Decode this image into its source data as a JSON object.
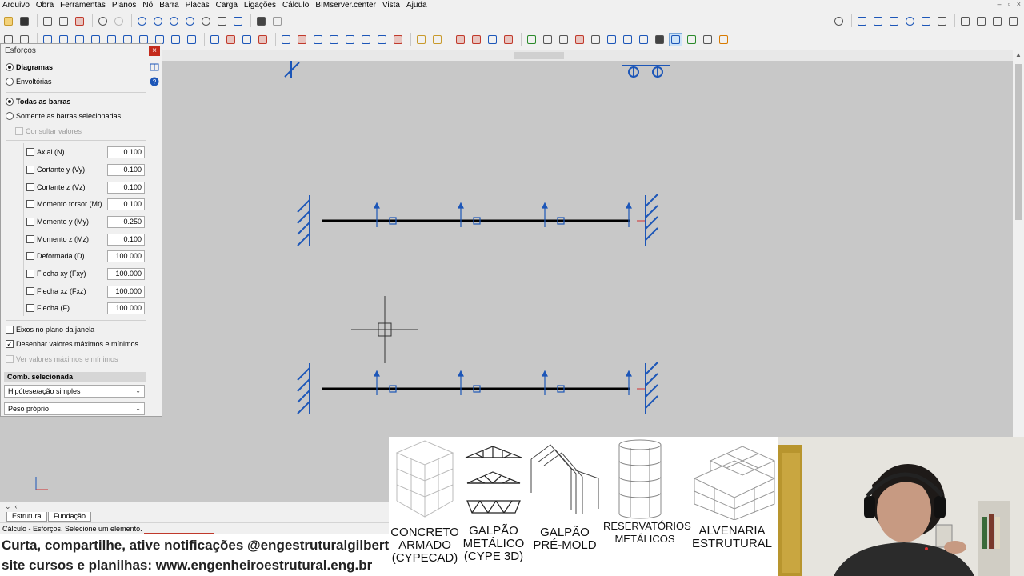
{
  "menu": {
    "items": [
      "Arquivo",
      "Obra",
      "Ferramentas",
      "Planos",
      "Nó",
      "Barra",
      "Placas",
      "Carga",
      "Ligações",
      "Cálculo",
      "BIMserver.center",
      "Vista",
      "Ajuda"
    ]
  },
  "panel": {
    "title": "Esforços",
    "close_label": "×",
    "mode_diagramas": "Diagramas",
    "mode_envoltorias": "Envoltórias",
    "bars_all": "Todas as barras",
    "bars_selected": "Somente as barras selecionadas",
    "consult_values": "Consultar valores",
    "efforts": [
      {
        "label": "Axial (N)",
        "value": "0.100"
      },
      {
        "label": "Cortante y (Vy)",
        "value": "0.100"
      },
      {
        "label": "Cortante z (Vz)",
        "value": "0.100"
      },
      {
        "label": "Momento torsor (Mt)",
        "value": "0.100"
      },
      {
        "label": "Momento y (My)",
        "value": "0.250"
      },
      {
        "label": "Momento z (Mz)",
        "value": "0.100"
      },
      {
        "label": "Deformada (D)",
        "value": "100.000"
      },
      {
        "label": "Flecha xy (Fxy)",
        "value": "100.000"
      },
      {
        "label": "Flecha xz (Fxz)",
        "value": "100.000"
      },
      {
        "label": "Flecha (F)",
        "value": "100.000"
      }
    ],
    "axes_in_window": "Eixos no plano da janela",
    "draw_max_min": "Desenhar valores máximos e mínimos",
    "view_max_min": "Ver valores máximos e mínimos",
    "comb_header": "Comb. selecionada",
    "select_hypothesis": "Hipótese/ação simples",
    "select_load": "Peso próprio"
  },
  "bottom": {
    "tab_estrutura": "Estrutura",
    "tab_fundacao": "Fundação",
    "status": "Cálculo - Esforços. Selecione um elemento.",
    "line1": "Curta, compartilhe, ative notificações @engestruturalgilberto",
    "line2": "site cursos e planilhas: www.engenheiroestrutural.eng.br"
  },
  "banner": {
    "items": [
      {
        "label": "CONCRETO\nARMADO\n(CYPECAD)"
      },
      {
        "label": "GALPÃO\nMETÁLICO\n(CYPE 3D)"
      },
      {
        "label": "GALPÃO\nPRÉ-MOLD"
      },
      {
        "label": "RESERVATÓRIOS\nMETÁLICOS"
      },
      {
        "label": "ALVENARIA\nESTRUTURAL"
      }
    ]
  },
  "colors": {
    "canvas": "#c8c8c8",
    "support_blue": "#1c56b8",
    "beam": "#000000",
    "close_red": "#c42b1c"
  }
}
